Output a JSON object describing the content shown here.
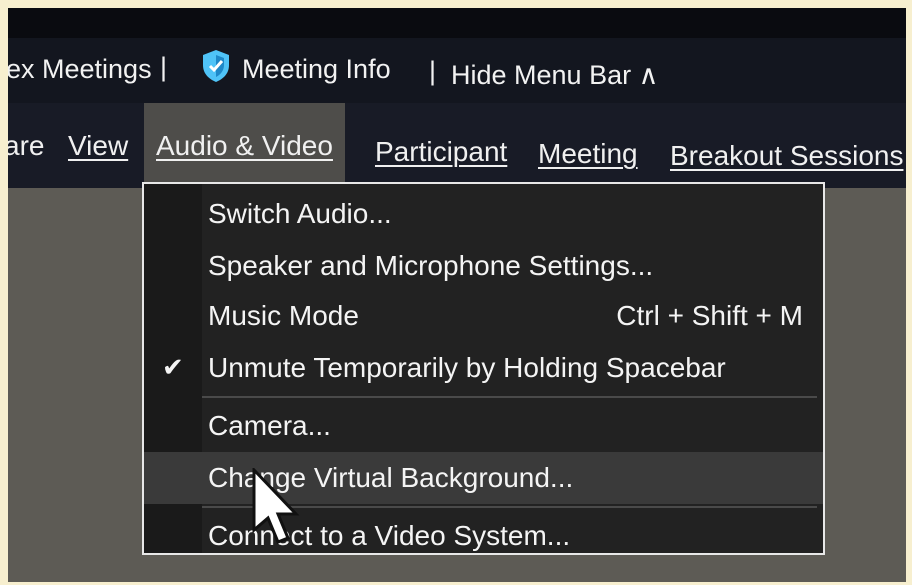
{
  "info_bar": {
    "meetings_label": "ex Meetings",
    "sep1": "|",
    "meeting_info_label": "Meeting Info",
    "sep2": "|",
    "hide_menu_label": "Hide Menu Bar ∧"
  },
  "menu": {
    "items": [
      {
        "label": "are"
      },
      {
        "label": "View"
      },
      {
        "label": "Audio & Video"
      },
      {
        "label": "Participant"
      },
      {
        "label": "Meeting"
      },
      {
        "label": "Breakout Sessions"
      }
    ]
  },
  "dropdown": {
    "items": [
      {
        "label": "Switch Audio...",
        "shortcut": ""
      },
      {
        "label": "Speaker and Microphone Settings...",
        "shortcut": ""
      },
      {
        "label": "Music Mode",
        "shortcut": "Ctrl + Shift + M"
      },
      {
        "label": "Unmute Temporarily by Holding Spacebar",
        "shortcut": "",
        "checked": true,
        "check": "✔"
      },
      {
        "label": "Camera...",
        "shortcut": ""
      },
      {
        "label": "Change Virtual Background...",
        "shortcut": ""
      },
      {
        "label": "Connect to a Video System...",
        "shortcut": ""
      }
    ]
  },
  "colors": {
    "accent_shield": "#4fc3f7",
    "menu_bg": "#181b26",
    "dropdown_bg": "#222222"
  }
}
